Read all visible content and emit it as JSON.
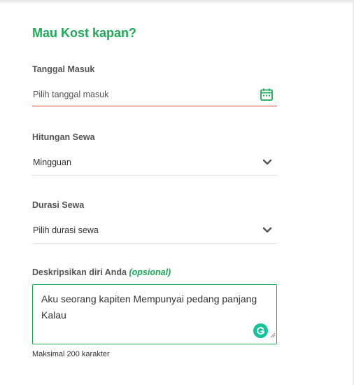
{
  "form": {
    "title": "Mau Kost kapan?",
    "tanggal_masuk": {
      "label": "Tanggal Masuk",
      "placeholder": "Pilih tanggal masuk",
      "icon": "calendar-icon"
    },
    "hitungan_sewa": {
      "label": "Hitungan Sewa",
      "value": "Mingguan",
      "icon": "chevron-down-icon"
    },
    "durasi_sewa": {
      "label": "Durasi Sewa",
      "placeholder": "Pilih durasi sewa",
      "icon": "chevron-down-icon"
    },
    "deskripsi": {
      "label": "Deskripsikan diri Anda",
      "optional": "(opsional)",
      "lines": [
        "Aku seorang kapiten Mempunyai pedang panjang",
        "Kalau"
      ],
      "helper": "Maksimal 200 karakter",
      "grammarly_icon": "grammarly-icon"
    }
  },
  "colors": {
    "accent": "#1baa56",
    "error": "#e03c31",
    "grammarly": "#15c39a"
  }
}
